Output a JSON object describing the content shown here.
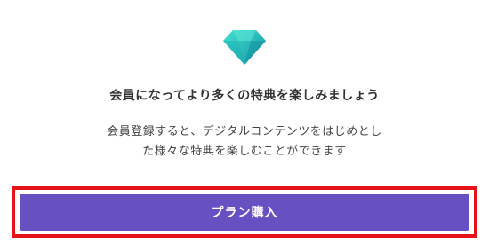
{
  "promo": {
    "icon": "diamond-icon",
    "title": "会員になってより多くの特典を楽しみましょう",
    "description_lines": [
      "会員登録すると、デジタルコンテンツをはじめとし",
      "た様々な特典を楽しむことができます"
    ],
    "cta_label": "プラン購入",
    "colors": {
      "gem_light": "#33d1c6",
      "gem_dark": "#1aa3a6",
      "button": "#6650c2",
      "highlight_border": "#e5121a"
    }
  }
}
